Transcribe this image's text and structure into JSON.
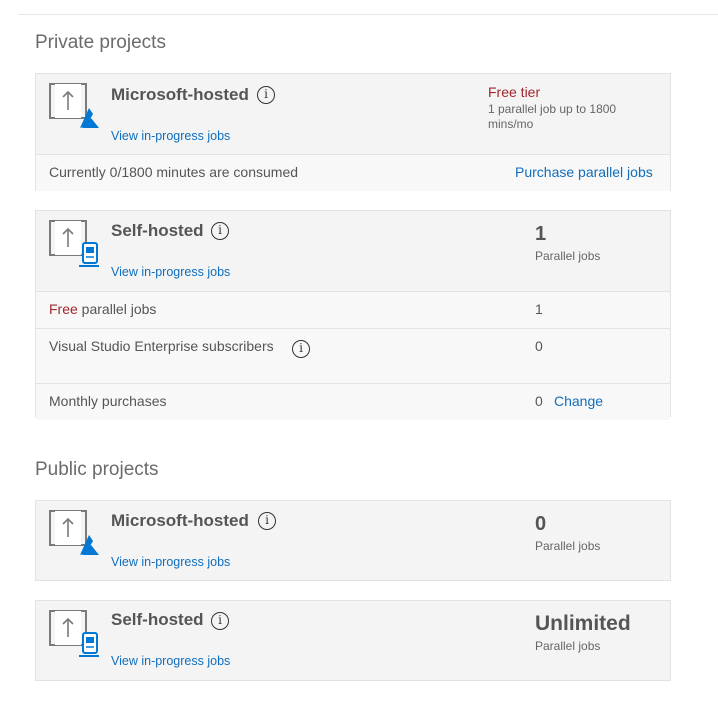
{
  "private": {
    "title": "Private projects",
    "hosted": {
      "name": "Microsoft-hosted",
      "view_link": "View in-progress jobs",
      "tier_title": "Free tier",
      "tier_desc": "1 parallel job up to 1800 mins/mo",
      "consumed_text": "Currently 0/1800 minutes are consumed",
      "purchase_link": "Purchase parallel jobs"
    },
    "self": {
      "name": "Self-hosted",
      "view_link": "View in-progress jobs",
      "count": "1",
      "count_label": "Parallel jobs",
      "rows": {
        "free_prefix": "Free",
        "free_suffix": " parallel jobs",
        "free_value": "1",
        "vs_label": "Visual Studio Enterprise subscribers",
        "vs_value": "0",
        "monthly_label": "Monthly purchases",
        "monthly_value": "0",
        "change_link": "Change"
      }
    }
  },
  "public": {
    "title": "Public projects",
    "hosted": {
      "name": "Microsoft-hosted",
      "view_link": "View in-progress jobs",
      "count": "0",
      "count_label": "Parallel jobs"
    },
    "self": {
      "name": "Self-hosted",
      "view_link": "View in-progress jobs",
      "count": "Unlimited",
      "count_label": "Parallel jobs"
    }
  },
  "info_glyph": "i",
  "icons": {
    "hosted": "pipeline-azure-icon",
    "self": "pipeline-agent-icon",
    "info": "info-icon"
  },
  "colors": {
    "link": "#106ebe",
    "free_red": "#a4262c",
    "azure_blue": "#0078d4"
  }
}
